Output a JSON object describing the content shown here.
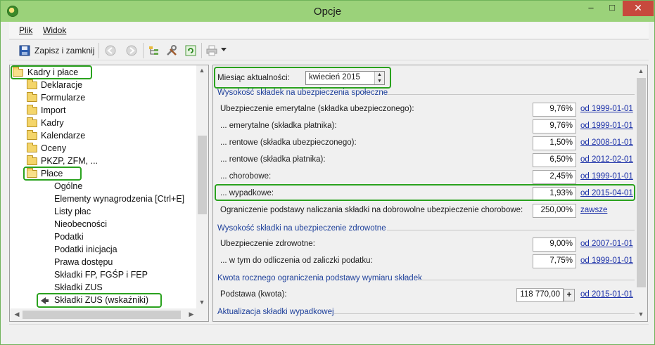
{
  "window": {
    "title": "Opcje",
    "controls": {
      "minimize": "‒",
      "maximize": "□",
      "close": "✕"
    }
  },
  "menu": {
    "plik": "Plik",
    "widok": "Widok"
  },
  "toolbar": {
    "save_close": "Zapisz i zamknij",
    "icons": [
      "save-icon",
      "back-icon",
      "forward-icon",
      "tree-settings-icon",
      "tools-icon",
      "refresh-icon",
      "print-icon",
      "dropdown-arrow-icon"
    ]
  },
  "tree": {
    "root": "Kadry i płace",
    "folders": [
      "Deklaracje",
      "Formularze",
      "Import",
      "Kadry",
      "Kalendarze",
      "Oceny",
      "PKZP, ZFM, ..."
    ],
    "open_folder": "Płace",
    "leaves": [
      "Ogólne",
      "Elementy wynagrodzenia [Ctrl+E]",
      "Listy płac",
      "Nieobecności",
      "Podatki",
      "Podatki inicjacja",
      "Prawa dostępu",
      "Składki FP, FGŚP i FEP",
      "Składki ZUS"
    ],
    "selected": "Składki ZUS (wskaźniki)"
  },
  "panel": {
    "month_label": "Miesiąc aktualności:",
    "month_value": "kwiecień 2015",
    "section1": "Wysokość składek na ubezpieczenia społeczne",
    "rows1": [
      {
        "label": "Ubezpieczenie emerytalne (składka ubezpieczonego):",
        "value": "9,76%",
        "link": "od 1999-01-01"
      },
      {
        "label": "... emerytalne (składka płatnika):",
        "value": "9,76%",
        "link": "od 1999-01-01"
      },
      {
        "label": "... rentowe (składka ubezpieczonego):",
        "value": "1,50%",
        "link": "od 2008-01-01"
      },
      {
        "label": "... rentowe (składka płatnika):",
        "value": "6,50%",
        "link": "od 2012-02-01"
      },
      {
        "label": "... chorobowe:",
        "value": "2,45%",
        "link": "od 1999-01-01"
      },
      {
        "label": "... wypadkowe:",
        "value": "1,93%",
        "link": "od 2015-04-01"
      },
      {
        "label": "Ograniczenie podstawy naliczania składki na dobrowolne ubezpieczenie chorobowe:",
        "value": "250,00%",
        "link": "zawsze"
      }
    ],
    "section2": "Wysokość składki na ubezpieczenie zdrowotne",
    "rows2": [
      {
        "label": "Ubezpieczenie zdrowotne:",
        "value": "9,00%",
        "link": "od 2007-01-01"
      },
      {
        "label": "... w tym do odliczenia od zaliczki podatku:",
        "value": "7,75%",
        "link": "od 1999-01-01"
      }
    ],
    "section3": "Kwota rocznego ograniczenia podstawy wymiaru składek",
    "row3": {
      "label": "Podstawa (kwota):",
      "value": "118 770,00",
      "link": "od 2015-01-01",
      "button": "+"
    },
    "section4": "Aktualizacja składki wypadkowej"
  },
  "colors": {
    "titlebar": "#9bd27a",
    "highlight": "#2aa21e",
    "link": "#1a2fa8",
    "section": "#1d3f9a"
  }
}
